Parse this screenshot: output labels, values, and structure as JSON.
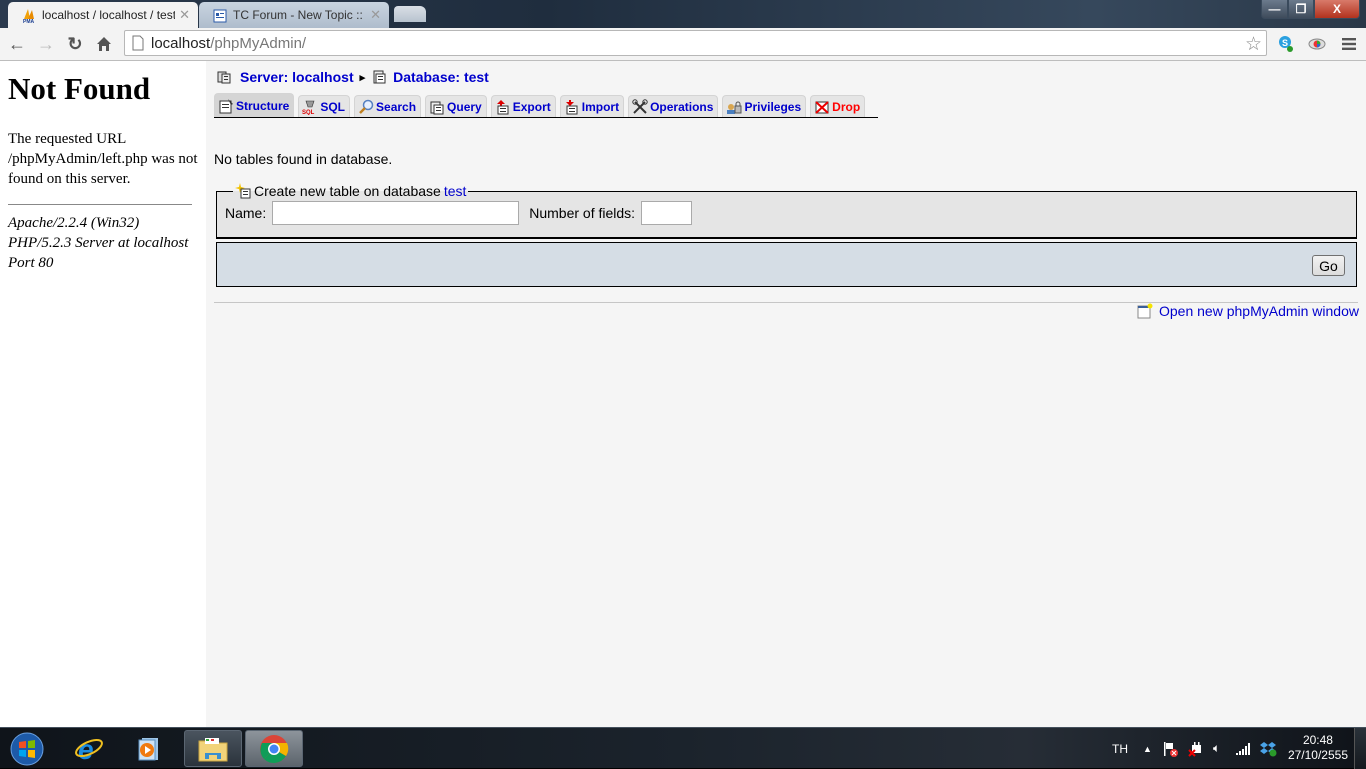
{
  "browser": {
    "tabs": [
      {
        "title": "localhost / localhost / test",
        "favicon": "phpmyadmin-icon",
        "active": true
      },
      {
        "title": "TC Forum - New Topic :: ข",
        "favicon": "forum-icon",
        "active": false
      }
    ],
    "url_host": "localhost",
    "url_path": "/phpMyAdmin/",
    "window_controls": {
      "minimize": "—",
      "maximize": "❐",
      "close": "X"
    }
  },
  "left_frame": {
    "heading": "Not Found",
    "message": "The requested URL /phpMyAdmin/left.php was not found on this server.",
    "address": "Apache/2.2.4 (Win32) PHP/5.2.3 Server at localhost Port 80"
  },
  "breadcrumb": {
    "server": "Server: localhost",
    "separator": "▸",
    "database": "Database: test"
  },
  "tabs": [
    {
      "label": "Structure",
      "icon": "structure-icon",
      "active": true
    },
    {
      "label": "SQL",
      "icon": "sql-icon"
    },
    {
      "label": "Search",
      "icon": "search-icon"
    },
    {
      "label": "Query",
      "icon": "query-icon"
    },
    {
      "label": "Export",
      "icon": "export-icon"
    },
    {
      "label": "Import",
      "icon": "import-icon"
    },
    {
      "label": "Operations",
      "icon": "operations-icon"
    },
    {
      "label": "Privileges",
      "icon": "privileges-icon"
    },
    {
      "label": "Drop",
      "icon": "drop-icon"
    }
  ],
  "main": {
    "no_tables": "No tables found in database.",
    "create": {
      "legend_prefix": "Create new table on database",
      "legend_db": "test",
      "name_label": "Name:",
      "name_value": "",
      "fields_label": "Number of fields:",
      "fields_value": "",
      "go_label": "Go"
    },
    "new_window_link": "Open new phpMyAdmin window"
  },
  "taskbar": {
    "language": "TH",
    "time": "20:48",
    "date": "27/10/2555"
  }
}
